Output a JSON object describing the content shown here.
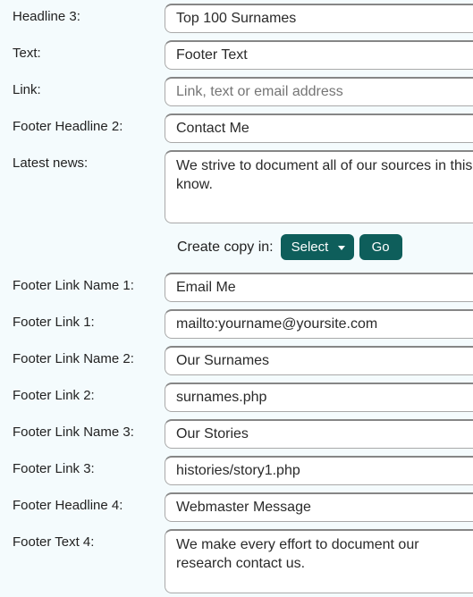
{
  "fields": {
    "headline3": {
      "label": "Headline 3:",
      "value": "Top 100 Surnames"
    },
    "text": {
      "label": "Text:",
      "value": "Footer Text"
    },
    "link": {
      "label": "Link:",
      "value": "",
      "placeholder": "Link, text or email address"
    },
    "footer_headline2": {
      "label": "Footer Headline 2:",
      "value": "Contact Me"
    },
    "latest_news": {
      "label": "Latest news:",
      "value": "We strive to document all of our sources in this know."
    },
    "footer_link_name1": {
      "label": "Footer Link Name 1:",
      "value": "Email Me"
    },
    "footer_link1": {
      "label": "Footer Link 1:",
      "value": "mailto:yourname@yoursite.com"
    },
    "footer_link_name2": {
      "label": "Footer Link Name 2:",
      "value": "Our Surnames"
    },
    "footer_link2": {
      "label": "Footer Link 2:",
      "value": "surnames.php"
    },
    "footer_link_name3": {
      "label": "Footer Link Name 3:",
      "value": "Our Stories"
    },
    "footer_link3": {
      "label": "Footer Link 3:",
      "value": "histories/story1.php"
    },
    "footer_headline4": {
      "label": "Footer Headline 4:",
      "value": "Webmaster Message"
    },
    "footer_text4": {
      "label": "Footer Text 4:",
      "value": "We make every effort to document our research contact us."
    }
  },
  "copy": {
    "label": "Create copy in:",
    "selected": "Select",
    "go": "Go"
  }
}
